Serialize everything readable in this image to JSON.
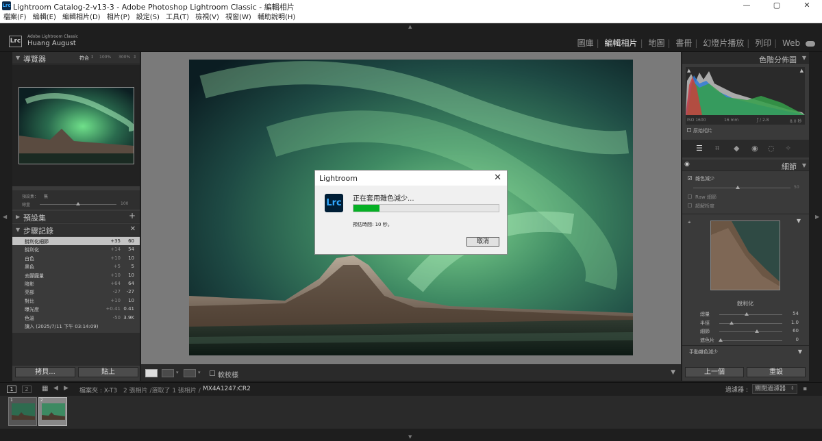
{
  "window": {
    "title": "Lightroom Catalog-2-v13-3 - Adobe Photoshop Lightroom Classic - 編輯相片",
    "app_icon": "Lrc"
  },
  "menu": [
    "檔案(F)",
    "編輯(E)",
    "編輯相片(D)",
    "相片(P)",
    "設定(S)",
    "工具(T)",
    "檢視(V)",
    "視窗(W)",
    "輔助說明(H)"
  ],
  "identity": {
    "logo": "Lrc",
    "product": "Adobe Lightroom Classic",
    "user": "Huang August"
  },
  "modules": [
    {
      "label": "圖庫",
      "active": false
    },
    {
      "label": "編輯相片",
      "active": true
    },
    {
      "label": "地圖",
      "active": false
    },
    {
      "label": "書冊",
      "active": false
    },
    {
      "label": "幻燈片播放",
      "active": false
    },
    {
      "label": "列印",
      "active": false
    },
    {
      "label": "Web",
      "active": false
    }
  ],
  "navigator": {
    "title": "導覽器",
    "fit": "符合",
    "zoom1": "100%",
    "zoom2": "300%"
  },
  "preset_amount": {
    "preset_label": "預設集：",
    "preset_value": "無",
    "amount_label": "總量",
    "amount_value": "100",
    "amount": 1.0
  },
  "presets": {
    "title": "預設集"
  },
  "history": {
    "title": "步驟記錄",
    "items": [
      {
        "name": "銳利化細節",
        "a": "+35",
        "b": "60",
        "selected": true
      },
      {
        "name": "銳利化",
        "a": "+14",
        "b": "54"
      },
      {
        "name": "白色",
        "a": "+10",
        "b": "10"
      },
      {
        "name": "黑色",
        "a": "+5",
        "b": "5"
      },
      {
        "name": "去朦朧量",
        "a": "+10",
        "b": "10"
      },
      {
        "name": "陰影",
        "a": "+64",
        "b": "64"
      },
      {
        "name": "亮部",
        "a": "-27",
        "b": "-27"
      },
      {
        "name": "對比",
        "a": "+10",
        "b": "10"
      },
      {
        "name": "曝光度",
        "a": "+0.41",
        "b": "0.41"
      },
      {
        "name": "色溫",
        "a": "-50",
        "b": "3.9K"
      },
      {
        "name": "讀入 (2025/7/11 下午 03:14:09)",
        "a": "",
        "b": ""
      }
    ]
  },
  "left_buttons": {
    "copy": "拷貝...",
    "paste": "貼上"
  },
  "toolbar": {
    "softproof": "軟校樣"
  },
  "dialog": {
    "title": "Lightroom",
    "message": "正在套用雜色減少...",
    "eta": "預估時間: 10 秒。",
    "cancel": "取消",
    "progress": 0.18,
    "close": "✕",
    "icon": "Lrc"
  },
  "histogram": {
    "title": "色階分佈圖",
    "iso": "ISO 1600",
    "focal": "16 mm",
    "aperture": "ƒ / 2.8",
    "shutter": "8.0 秒",
    "original": "原始相片"
  },
  "detail": {
    "title": "細節",
    "denoise": "雜色減少",
    "amount_value": "50",
    "raw": "Raw 細節",
    "super": "超解析度",
    "sharpen_title": "銳利化",
    "sliders": [
      {
        "label": "總量",
        "value": "54",
        "pos": 0.43
      },
      {
        "label": "半徑",
        "value": "1.0",
        "pos": 0.2
      },
      {
        "label": "細節",
        "value": "60",
        "pos": 0.6
      },
      {
        "label": "遮色片",
        "value": "0",
        "pos": 0.02
      }
    ],
    "manual": "手動雜色減少"
  },
  "right_buttons": {
    "prev": "上一個",
    "reset": "重設"
  },
  "filmbar": {
    "folder": "檔案夾 : X-T3",
    "count": "2 張相片 /選取了 1 張相片 /",
    "file": "MX4A1247.CR2",
    "filter_label": "過濾器 :",
    "filter_value": "關閉過濾器",
    "page1": "1",
    "page2": "2"
  },
  "filmstrip": [
    {
      "index": "1"
    },
    {
      "index": "2"
    }
  ]
}
